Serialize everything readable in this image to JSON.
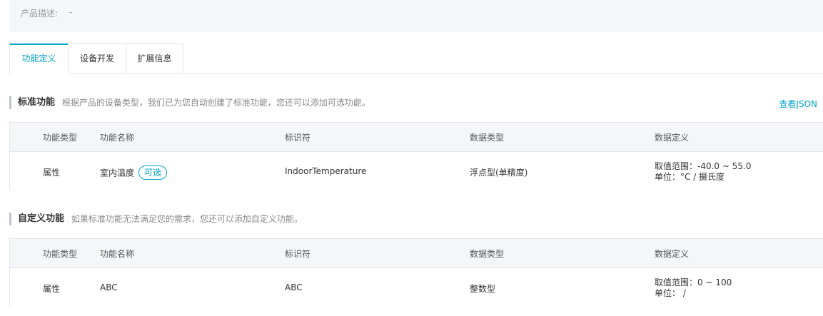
{
  "product": {
    "description_label": "产品描述:",
    "description_value": "-"
  },
  "tabs": [
    {
      "label": "功能定义",
      "active": true
    },
    {
      "label": "设备开发",
      "active": false
    },
    {
      "label": "扩展信息",
      "active": false
    }
  ],
  "standard": {
    "title": "标准功能",
    "hint": "根据产品的设备类型，我们已为您自动创建了标准功能，您还可以添加可选功能。",
    "json_link": "查看JSON",
    "columns": [
      "功能类型",
      "功能名称",
      "标识符",
      "数据类型",
      "数据定义"
    ],
    "rows": [
      {
        "type": "属性",
        "name": "室内温度",
        "badge": "可选",
        "identifier": "IndoorTemperature",
        "data_type": "浮点型(单精度)",
        "def_range": "取值范围：-40.0 ~ 55.0",
        "def_unit": "单位：°C / 摄氏度"
      }
    ]
  },
  "custom": {
    "title": "自定义功能",
    "hint": "如果标准功能无法满足您的需求，您还可以添加自定义功能。",
    "columns": [
      "功能类型",
      "功能名称",
      "标识符",
      "数据类型",
      "数据定义"
    ],
    "rows": [
      {
        "type": "属性",
        "name": "ABC",
        "identifier": "ABC",
        "data_type": "整数型",
        "def_range": "取值范围：0 ~ 100",
        "def_unit": "单位： /"
      }
    ]
  },
  "colors": {
    "accent": "#00a2ca",
    "panel_bg": "#f5f6fa",
    "border": "#e6e6e6"
  }
}
